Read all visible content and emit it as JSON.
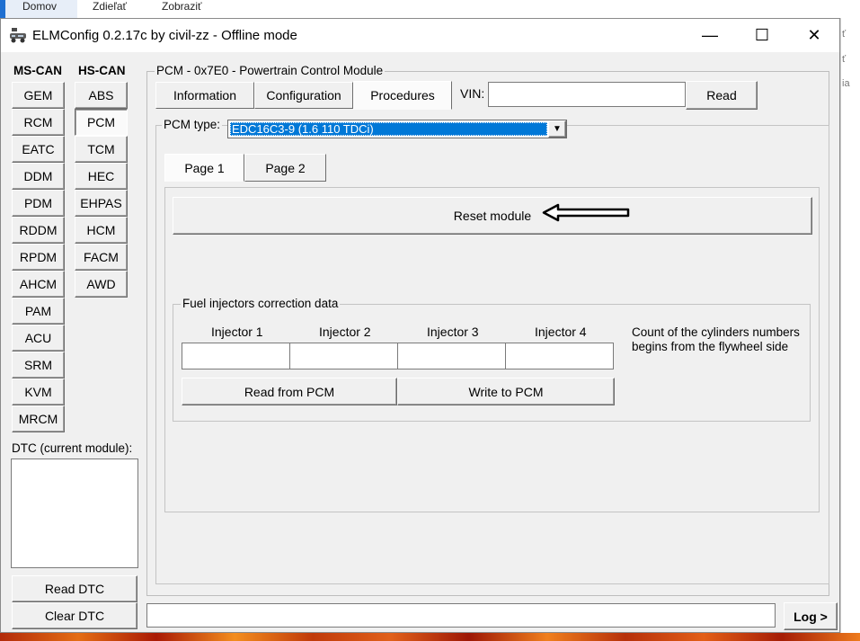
{
  "taskbar": {
    "tabs": [
      "Domov",
      "Zdieľať",
      "Zobraziť"
    ],
    "right_fragments": [
      "ť",
      "ť",
      "ia"
    ]
  },
  "window": {
    "title": "ELMConfig 0.2.17c by civil-zz - Offline mode",
    "minimize": "—",
    "maximize": "☐",
    "close": "✕"
  },
  "sidebar": {
    "ms_can_header": "MS-CAN",
    "hs_can_header": "HS-CAN",
    "ms_can": [
      "GEM",
      "RCM",
      "EATC",
      "DDM",
      "PDM",
      "RDDM",
      "RPDM",
      "AHCM",
      "PAM",
      "ACU",
      "SRM",
      "KVM",
      "MRCM"
    ],
    "hs_can": [
      "ABS",
      "PCM",
      "TCM",
      "HEC",
      "EHPAS",
      "HCM",
      "FACM",
      "AWD"
    ],
    "hs_can_selected": "PCM",
    "dtc_label": "DTC (current module):",
    "read_dtc": "Read DTC",
    "clear_dtc": "Clear DTC"
  },
  "module": {
    "group_title": "PCM - 0x7E0 - Powertrain Control Module",
    "tabs": [
      "Information",
      "Configuration",
      "Procedures"
    ],
    "active_tab": "Procedures",
    "vin_label": "VIN:",
    "vin_value": "",
    "read_button": "Read"
  },
  "pcm_type": {
    "label": "PCM type:",
    "value": "EDC16C3-9 (1.6 110 TDCi)"
  },
  "pages": {
    "tabs": [
      "Page 1",
      "Page 2"
    ],
    "active": "Page 1"
  },
  "procedures": {
    "reset_module": "Reset module"
  },
  "injectors": {
    "group_title": "Fuel injectors correction data",
    "headers": [
      "Injector 1",
      "Injector 2",
      "Injector 3",
      "Injector 4"
    ],
    "values": [
      "",
      "",
      "",
      ""
    ],
    "note": [
      "Count of the cylinders numbers",
      "begins from the flywheel side"
    ],
    "read_button": "Read from PCM",
    "write_button": "Write to PCM"
  },
  "statusbar": {
    "log_value": "",
    "log_button": "Log >"
  },
  "colors": {
    "selection": "#0078d7",
    "window_bg": "#f0f0f0",
    "accent": "#1f6fd1"
  }
}
